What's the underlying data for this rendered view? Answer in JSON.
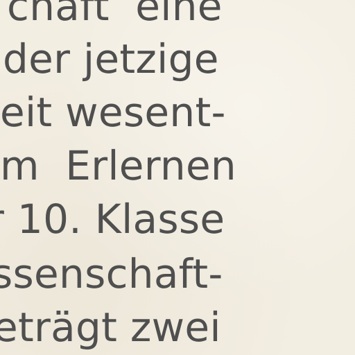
{
  "document": {
    "lines": [
      "chaft  eine",
      "der jetzige",
      "eit wesent-",
      "m  Erlernen",
      "r 10. Klasse",
      "ssenschaft-",
      "eträgt zwei"
    ]
  }
}
